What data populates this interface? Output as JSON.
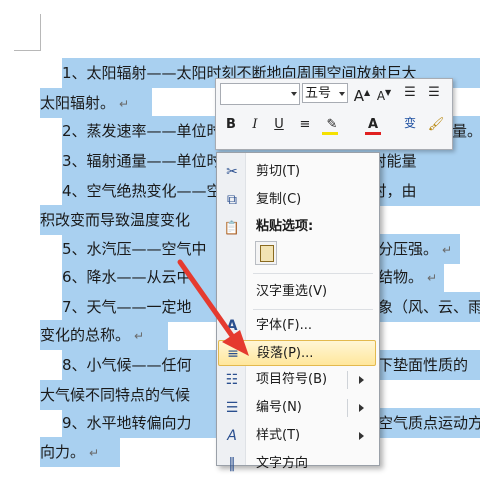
{
  "document": {
    "lines": [
      {
        "text": "1、太阳辐射——太阳时刻不断地向周围空间放射巨大",
        "mark": false
      },
      {
        "text": "太阳辐射。",
        "mark": true
      },
      {
        "text": "2、蒸发速率——单位时间内",
        "mark": false
      },
      {
        "text": "3、辐射通量——单位时间通过任意面积上的辐射能量",
        "mark": false
      },
      {
        "text": "4、空气绝热变化——空气块与外界无热量收支时，由",
        "mark": false
      },
      {
        "text": "积改变而导致温度变化",
        "mark": false
      },
      {
        "text": "5、水汽压——空气中",
        "mark": false
      },
      {
        "text": "6、降水——从云中",
        "mark": false
      },
      {
        "text": "7、天气——一定地",
        "mark": false
      },
      {
        "text": "变化的总称。",
        "mark": true
      },
      {
        "text": "8、小气候——任何",
        "mark": false
      },
      {
        "text": "大气候不同特点的气候",
        "mark": false
      },
      {
        "text": "9、水平地转偏向力",
        "mark": false
      },
      {
        "text": "向力。",
        "mark": true
      }
    ],
    "right_fragments": [
      {
        "text": "量。",
        "mark": true
      },
      {
        "text": "分压强。",
        "mark": true
      },
      {
        "text": "结物。",
        "mark": true
      },
      {
        "text": "象（风、云、雨",
        "mark": false
      },
      {
        "text": "下垫面性质的",
        "mark": false
      },
      {
        "text": "空气质点运动方",
        "mark": false
      }
    ],
    "paragraph_mark": "↵"
  },
  "mini_toolbar": {
    "font_name": "",
    "font_size": "五号",
    "grow_font": "A",
    "shrink_font": "A",
    "bold": "B",
    "italic": "I",
    "underline": "U",
    "font_color_letter": "A",
    "phonetic": "变"
  },
  "context_menu": {
    "items": [
      {
        "label": "剪切(T)",
        "icon": "scissors-icon"
      },
      {
        "label": "复制(C)",
        "icon": "copy-icon"
      },
      {
        "label": "粘贴选项:",
        "icon": "paste-icon"
      },
      {
        "label": "汉字重选(V)",
        "icon": ""
      },
      {
        "label": "字体(F)...",
        "icon": "font-icon"
      },
      {
        "label": "段落(P)...",
        "icon": "paragraph-icon"
      },
      {
        "label": "项目符号(B)",
        "icon": "bullets-icon"
      },
      {
        "label": "编号(N)",
        "icon": "numbering-icon"
      },
      {
        "label": "样式(T)",
        "icon": "styles-icon"
      },
      {
        "label": "文字方向",
        "icon": "text-direction-icon"
      }
    ],
    "highlighted_item": "段落(P)..."
  },
  "colors": {
    "selection": "#a9d0f0",
    "arrow": "#e53a2f",
    "font_color": "#e02020",
    "highlight_color": "#f5e100"
  }
}
